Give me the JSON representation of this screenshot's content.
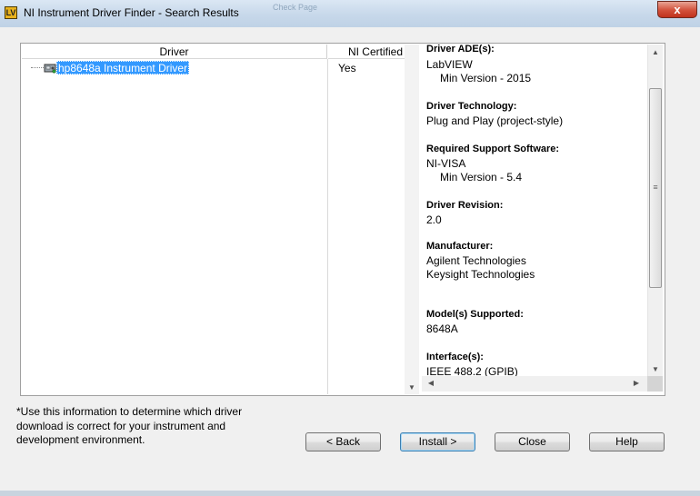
{
  "window": {
    "title": "NI Instrument Driver Finder - Search Results",
    "close_glyph": "x",
    "app_icon": "labview-icon",
    "ghost_text": "Check Page"
  },
  "list": {
    "headers": {
      "driver": "Driver",
      "certified": "NI Certified"
    },
    "rows": [
      {
        "name": "hp8648a Instrument Driver",
        "certified": "Yes",
        "icon": "instrument-driver-icon"
      }
    ]
  },
  "details": {
    "sections": [
      {
        "label": "Driver ADE(s):",
        "values": [
          "LabVIEW"
        ],
        "indented": [
          "Min Version - 2015"
        ]
      },
      {
        "label": "Driver Technology:",
        "values": [
          "Plug and Play (project-style)"
        ]
      },
      {
        "label": "Required Support Software:",
        "values": [
          "NI-VISA"
        ],
        "indented": [
          "Min Version - 5.4"
        ]
      },
      {
        "label": "Driver Revision:",
        "values": [
          "2.0"
        ]
      },
      {
        "label": "Manufacturer:",
        "values": [
          "Agilent Technologies",
          "Keysight Technologies"
        ]
      },
      {
        "label": "Model(s) Supported:",
        "values": [
          "8648A"
        ]
      },
      {
        "label": "Interface(s):",
        "values": [
          "IEEE 488.2 (GPIB)"
        ]
      }
    ]
  },
  "note": "*Use this information to determine which driver download is correct for your instrument and development environment.",
  "buttons": {
    "back": "< Back",
    "install": "Install >",
    "close": "Close",
    "help": "Help"
  },
  "scroll_glyphs": {
    "up": "▲",
    "down": "▼",
    "left": "◀",
    "right": "▶",
    "grip": "≡"
  }
}
